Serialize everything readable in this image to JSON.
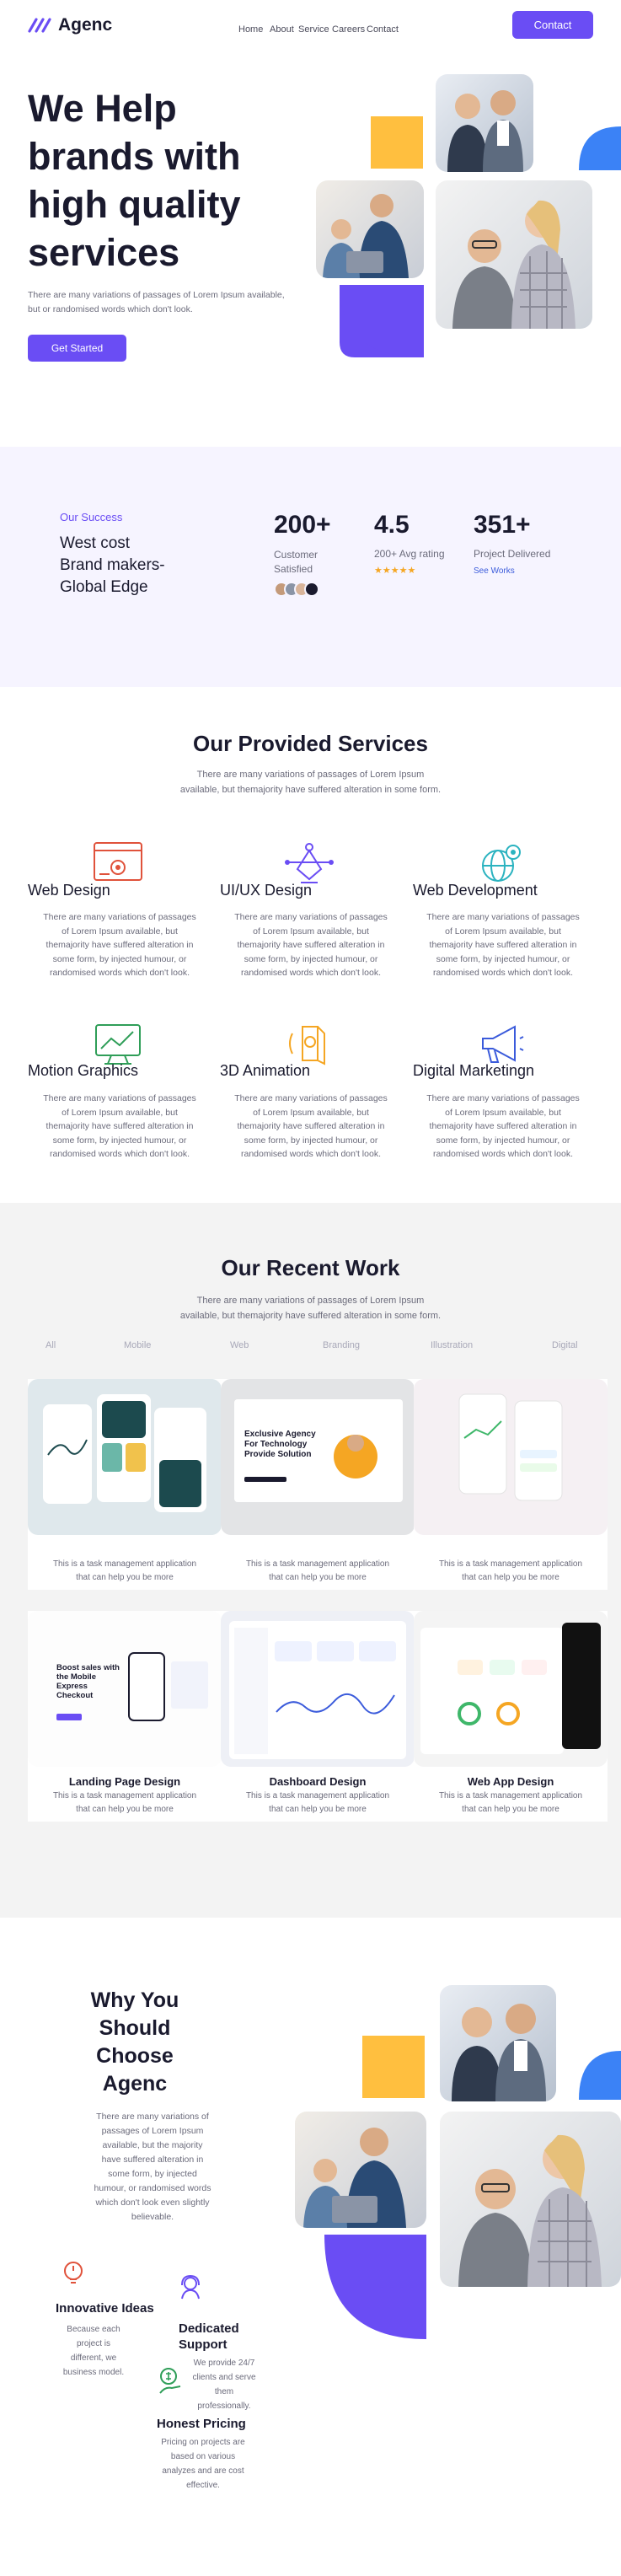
{
  "header": {
    "logo_text": "Agenc",
    "nav": [
      "Home",
      "About",
      "Service",
      "Careers",
      "Contact"
    ],
    "contact_button": "Contact"
  },
  "hero": {
    "title_lines": [
      "We Help",
      "brands with",
      "high quality",
      "services"
    ],
    "description": "There are many variations of passages of Lorem Ipsum available, but or randomised words which don't look.",
    "cta": "Get Started"
  },
  "success": {
    "eyebrow": "Our Success",
    "title_lines": [
      "West cost",
      "Brand makers-",
      "Global Edge"
    ],
    "stats": [
      {
        "value": "200+",
        "label": "Customer Satisfied"
      },
      {
        "value": "4.5",
        "label": "200+ Avg rating"
      },
      {
        "value": "351+",
        "label": "Project Delivered",
        "link": "See Works"
      }
    ],
    "rating_stars": 5
  },
  "services": {
    "title": "Our Provided Services",
    "subtitle": "There are many variations of passages of Lorem Ipsum available, but themajority have suffered alteration in some form.",
    "items": [
      {
        "title": "Web Design",
        "icon": "web-design-icon",
        "desc": "There are many variations of passages of Lorem Ipsum available, but themajority have suffered alteration in some form, by injected humour, or randomised words which don't look."
      },
      {
        "title": "UI/UX Design",
        "icon": "pen-tool-icon",
        "desc": "There are many variations of passages of Lorem Ipsum available, but themajority have suffered alteration in some form, by injected humour, or randomised words which don't look."
      },
      {
        "title": "Web Development",
        "icon": "globe-gear-icon",
        "desc": "There are many variations of passages of Lorem Ipsum available, but themajority have suffered alteration in some form, by injected humour, or randomised words which don't look."
      },
      {
        "title": "Motion Graphics",
        "icon": "monitor-chart-icon",
        "desc": "There are many variations of passages of Lorem Ipsum available, but themajority have suffered alteration in some form, by injected humour, or randomised words which don't look."
      },
      {
        "title": "3D Animation",
        "icon": "cube-icon",
        "desc": "There are many variations of passages of Lorem Ipsum available, but themajority have suffered alteration in some form, by injected humour, or randomised words which don't look."
      },
      {
        "title": "Digital Marketingn",
        "icon": "megaphone-icon",
        "desc": "There are many variations of passages of Lorem Ipsum available, but themajority have suffered alteration in some form, by injected humour, or randomised words which don't look."
      }
    ]
  },
  "work": {
    "title": "Our Recent Work",
    "subtitle": "There are many variations of passages of Lorem Ipsum available, but themajority have suffered alteration in some form.",
    "filters": [
      "All",
      "Mobile",
      "Web",
      "Branding",
      "Illustration",
      "Digital"
    ],
    "row1_desc": "This is a task management application that can help you be more",
    "featured_text": "Exclusive Agency For Technology Provide Solution",
    "cards": [
      {
        "title": "Landing Page Design",
        "desc": "This is a task management application that can help you be more",
        "thumb_text": "Boost sales with the Mobile Express Checkout"
      },
      {
        "title": "Dashboard Design",
        "desc": "This is a task management application that can help you be more"
      },
      {
        "title": "Web App Design",
        "desc": "This is a task management application that can help you be more"
      }
    ]
  },
  "why": {
    "title_lines": [
      "Why You",
      "Should",
      "Choose",
      "Agenc"
    ],
    "description": "There are many variations of passages of Lorem Ipsum available, but the majority have suffered alteration in some form, by injected humour, or randomised words which don't look even slightly believable.",
    "features": [
      {
        "title": "Innovative Ideas",
        "desc": "Because each project is different, we business model.",
        "icon": "lightbulb-icon"
      },
      {
        "title": "Dedicated Support",
        "desc": "We provide 24/7 clients and serve them professionally.",
        "icon": "support-agent-icon"
      },
      {
        "title": "Honest Pricing",
        "desc": "Pricing on projects are based on various analyzes and are cost effective.",
        "icon": "money-icon"
      }
    ]
  },
  "colors": {
    "accent": "#6a4df4",
    "yellow": "#ffbf3f",
    "blue": "#3b82f6",
    "lavender_bg": "#f6f4ff",
    "gray_bg": "#f3f3f3"
  }
}
